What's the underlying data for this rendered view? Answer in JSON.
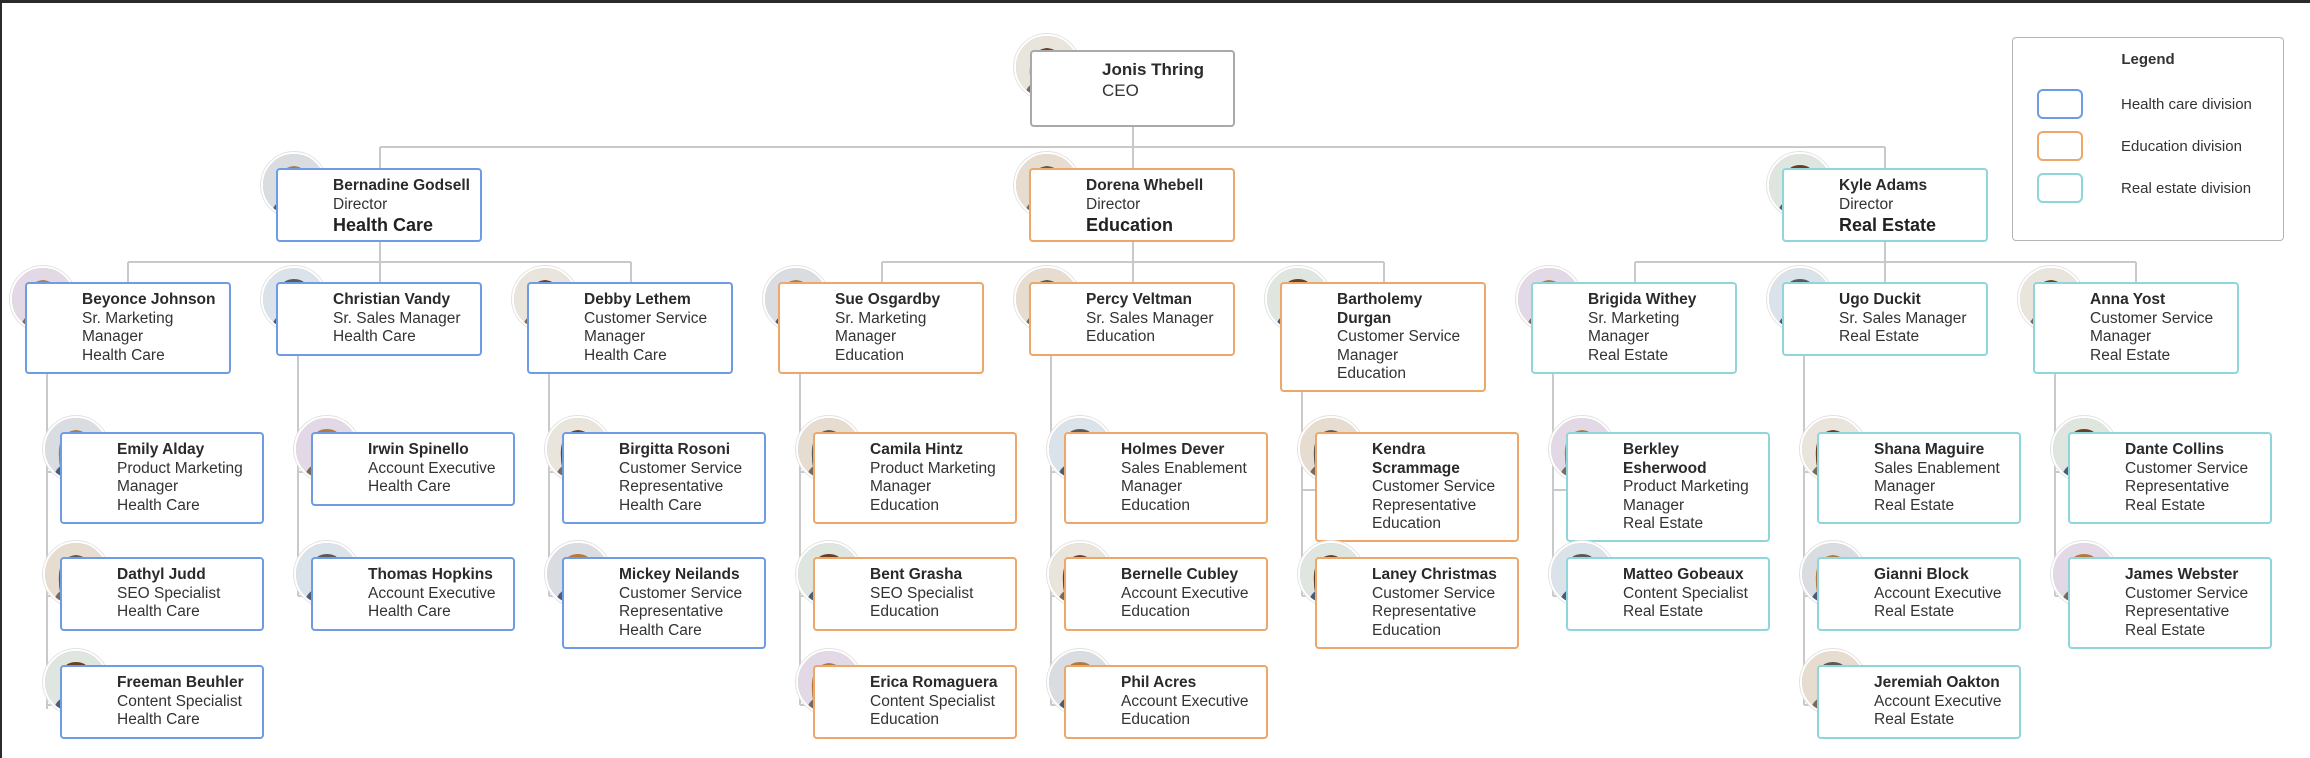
{
  "colors": {
    "health": "#6e9ce4",
    "education": "#eda768",
    "real_estate": "#8fd6db",
    "ceo": "#a9a9a9",
    "connector": "#c9c9c9"
  },
  "ceo": {
    "name": "Jonis Thring",
    "title": "CEO",
    "avatar": "woman-portrait"
  },
  "directors": [
    {
      "name": "Bernadine Godsell",
      "title": "Director",
      "dept": "Health Care",
      "division": "health",
      "avatar": "woman-portrait"
    },
    {
      "name": "Dorena Whebell",
      "title": "Director",
      "dept": "Education",
      "division": "education",
      "avatar": "woman-portrait"
    },
    {
      "name": "Kyle Adams",
      "title": "Director",
      "dept": "Real Estate",
      "division": "real_estate",
      "avatar": "man-portrait"
    }
  ],
  "managers": [
    {
      "name": "Beyonce Johnson",
      "title": "Sr. Marketing Manager",
      "dept": "Health Care",
      "division": "health",
      "avatar": "woman-portrait"
    },
    {
      "name": "Christian Vandy",
      "title": "Sr. Sales Manager",
      "dept": "Health Care",
      "division": "health",
      "avatar": "man-portrait"
    },
    {
      "name": "Debby Lethem",
      "title": "Customer Service Manager",
      "dept": "Health Care",
      "division": "health",
      "avatar": "woman-portrait"
    },
    {
      "name": "Sue Osgardby",
      "title": "Sr. Marketing Manager",
      "dept": "Education",
      "division": "education",
      "avatar": "woman-portrait"
    },
    {
      "name": "Percy Veltman",
      "title": "Sr. Sales Manager",
      "dept": "Education",
      "division": "education",
      "avatar": "woman-portrait"
    },
    {
      "name": "Bartholemy Durgan",
      "title": "Customer Service Manager",
      "dept": "Education",
      "division": "education",
      "avatar": "man-portrait"
    },
    {
      "name": "Brigida Withey",
      "title": "Sr. Marketing Manager",
      "dept": "Real Estate",
      "division": "real_estate",
      "avatar": "woman-portrait"
    },
    {
      "name": "Ugo Duckit",
      "title": "Sr. Sales Manager",
      "dept": "Real Estate",
      "division": "real_estate",
      "avatar": "man-portrait"
    },
    {
      "name": "Anna Yost",
      "title": "Customer Service Manager",
      "dept": "Real Estate",
      "division": "real_estate",
      "avatar": "woman-portrait"
    }
  ],
  "staff": [
    {
      "name": "Emily Alday",
      "title": "Product Marketing Manager",
      "dept": "Health Care",
      "division": "health",
      "avatar": "woman-portrait"
    },
    {
      "name": "Dathyl Judd",
      "title": "SEO Specialist",
      "dept": "Health Care",
      "division": "health",
      "avatar": "woman-portrait"
    },
    {
      "name": "Freeman Beuhler",
      "title": "Content Specialist",
      "dept": "Health Care",
      "division": "health",
      "avatar": "man-portrait"
    },
    {
      "name": "Irwin Spinello",
      "title": "Account Executive",
      "dept": "Health Care",
      "division": "health",
      "avatar": "man-portrait"
    },
    {
      "name": "Thomas Hopkins",
      "title": "Account Executive",
      "dept": "Health Care",
      "division": "health",
      "avatar": "man-portrait"
    },
    {
      "name": "Birgitta Rosoni",
      "title": "Customer Service Representative",
      "dept": "Health Care",
      "division": "health",
      "avatar": "woman-portrait"
    },
    {
      "name": "Mickey Neilands",
      "title": "Customer Service Representative",
      "dept": "Health Care",
      "division": "health",
      "avatar": "man-portrait"
    },
    {
      "name": "Camila Hintz",
      "title": "Product Marketing Manager",
      "dept": "Education",
      "division": "education",
      "avatar": "woman-portrait"
    },
    {
      "name": "Bent Grasha",
      "title": "SEO Specialist",
      "dept": "Education",
      "division": "education",
      "avatar": "man-portrait"
    },
    {
      "name": "Erica Romaguera",
      "title": "Content Specialist",
      "dept": "Education",
      "division": "education",
      "avatar": "woman-portrait"
    },
    {
      "name": "Holmes Dever",
      "title": "Sales Enablement Manager",
      "dept": "Education",
      "division": "education",
      "avatar": "man-portrait"
    },
    {
      "name": "Bernelle Cubley",
      "title": "Account Executive",
      "dept": "Education",
      "division": "education",
      "avatar": "woman-portrait"
    },
    {
      "name": "Phil Acres",
      "title": "Account Executive",
      "dept": "Education",
      "division": "education",
      "avatar": "man-portrait"
    },
    {
      "name": "Kendra Scrammage",
      "title": "Customer Service Representative",
      "dept": "Education",
      "division": "education",
      "avatar": "woman-portrait"
    },
    {
      "name": "Laney Christmas",
      "title": "Customer Service Representative",
      "dept": "Education",
      "division": "education",
      "avatar": "woman-portrait"
    },
    {
      "name": "Berkley Esherwood",
      "title": "Product Marketing Manager",
      "dept": "Real Estate",
      "division": "real_estate",
      "avatar": "woman-portrait"
    },
    {
      "name": "Matteo Gobeaux",
      "title": "Content Specialist",
      "dept": "Real Estate",
      "division": "real_estate",
      "avatar": "man-portrait"
    },
    {
      "name": "Shana Maguire",
      "title": "Sales Enablement Manager",
      "dept": "Real Estate",
      "division": "real_estate",
      "avatar": "woman-portrait"
    },
    {
      "name": "Gianni Block",
      "title": "Account Executive",
      "dept": "Real Estate",
      "division": "real_estate",
      "avatar": "woman-portrait"
    },
    {
      "name": "Jeremiah Oakton",
      "title": "Account Executive",
      "dept": "Real Estate",
      "division": "real_estate",
      "avatar": "man-portrait"
    },
    {
      "name": "Dante Collins",
      "title": "Customer Service Representative",
      "dept": "Real Estate",
      "division": "real_estate",
      "avatar": "man-portrait"
    },
    {
      "name": "James Webster",
      "title": "Customer Service Representative",
      "dept": "Real Estate",
      "division": "real_estate",
      "avatar": "man-portrait"
    }
  ],
  "legend": {
    "title": "Legend",
    "items": [
      {
        "label": "Health care division",
        "division": "health"
      },
      {
        "label": "Education division",
        "division": "education"
      },
      {
        "label": "Real estate division",
        "division": "real_estate"
      }
    ]
  }
}
